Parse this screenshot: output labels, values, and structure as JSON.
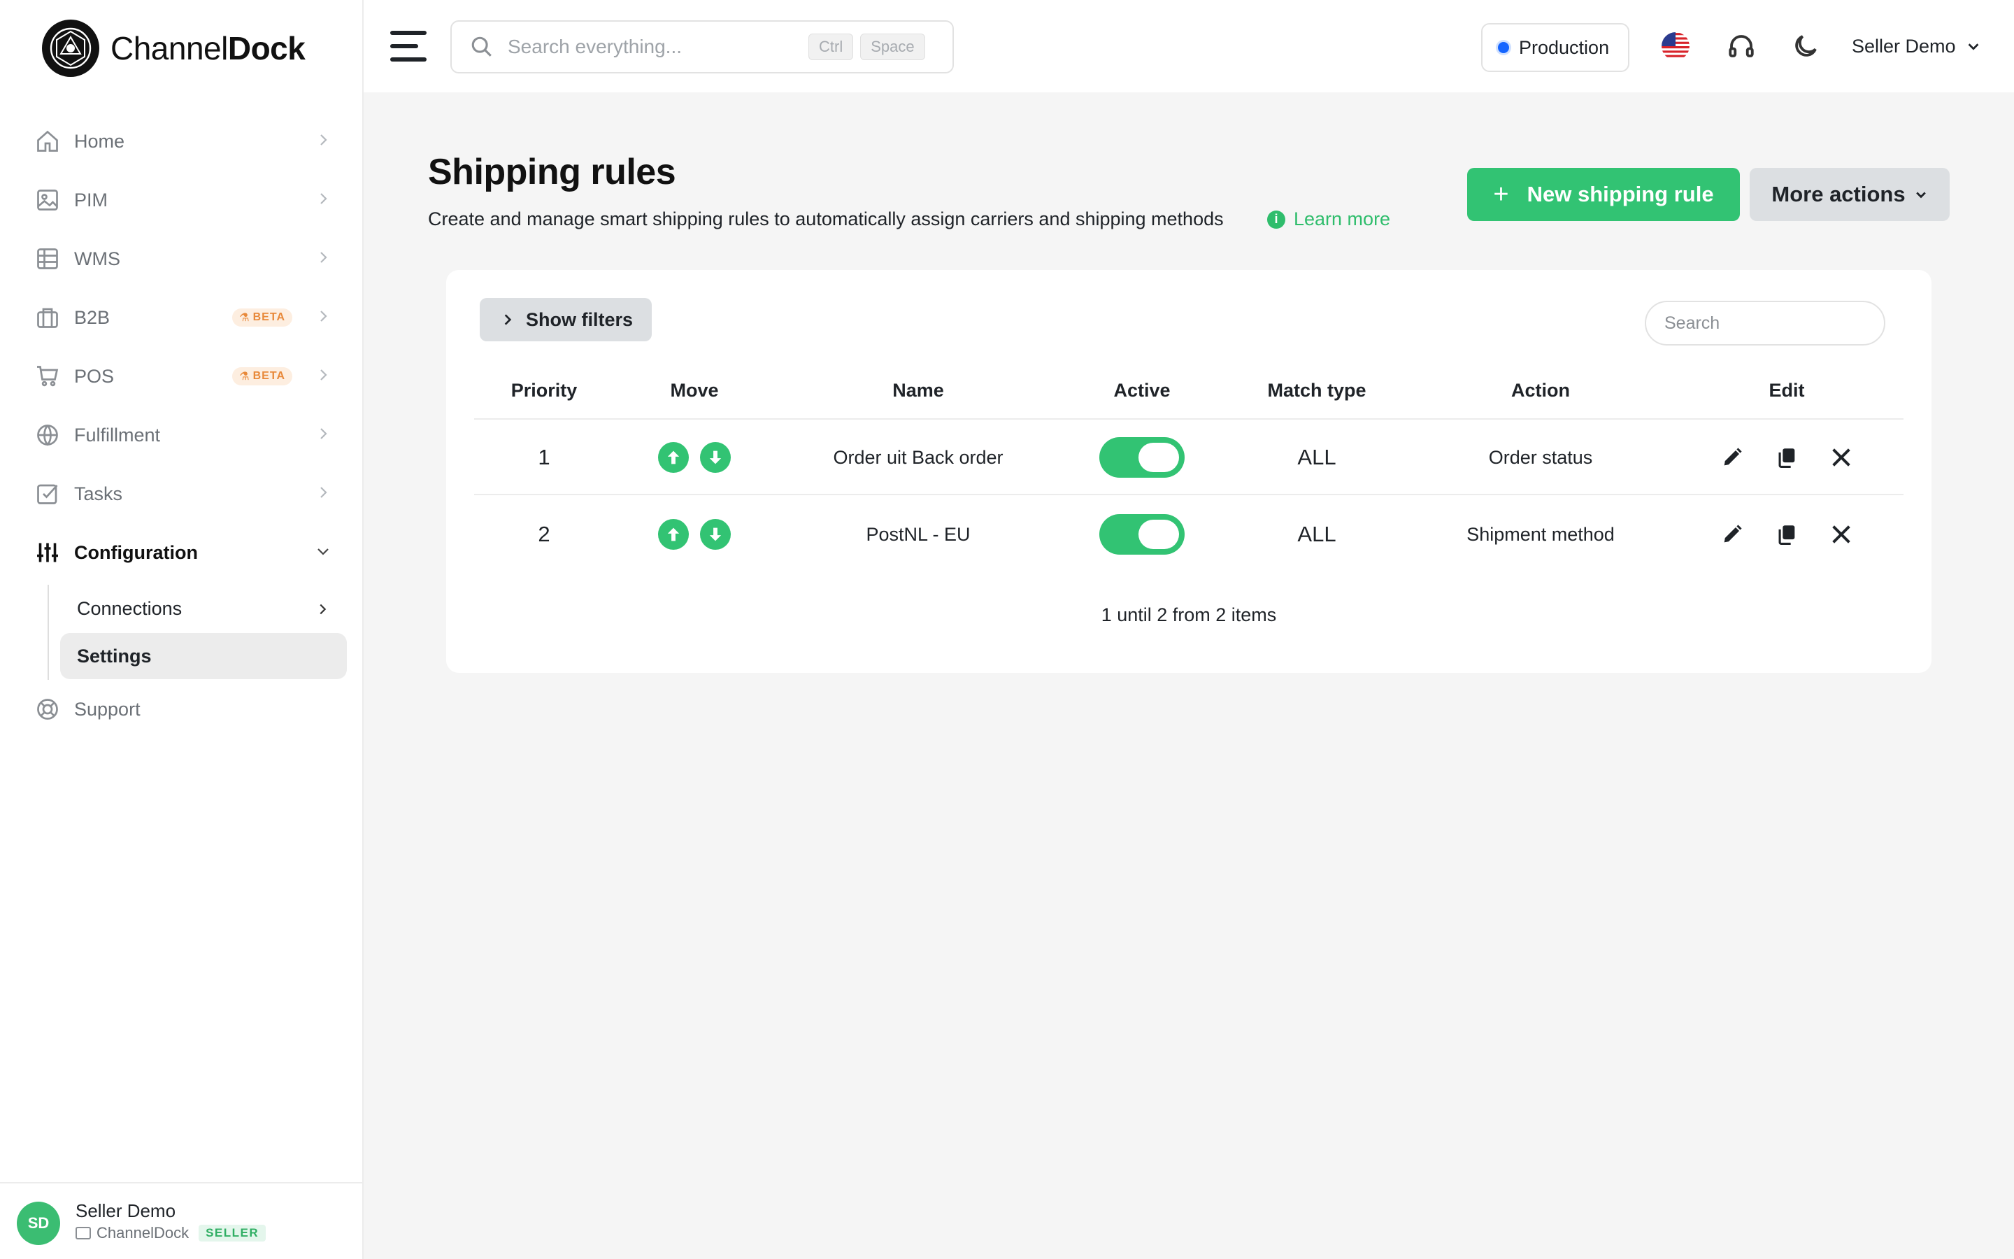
{
  "brand": {
    "name_light": "Channel",
    "name_bold": "Dock"
  },
  "sidebar": {
    "items": [
      {
        "label": "Home",
        "icon": "home-icon"
      },
      {
        "label": "PIM",
        "icon": "image-icon"
      },
      {
        "label": "WMS",
        "icon": "grid-icon"
      },
      {
        "label": "B2B",
        "icon": "briefcase-icon",
        "badge": "BETA"
      },
      {
        "label": "POS",
        "icon": "cart-icon",
        "badge": "BETA"
      },
      {
        "label": "Fulfillment",
        "icon": "globe-icon"
      },
      {
        "label": "Tasks",
        "icon": "checkbox-icon"
      },
      {
        "label": "Configuration",
        "icon": "sliders-icon",
        "expanded": true
      },
      {
        "label": "Support",
        "icon": "lifebuoy-icon"
      }
    ],
    "subitems": [
      {
        "label": "Connections"
      },
      {
        "label": "Settings",
        "selected": true
      }
    ],
    "user": {
      "initials": "SD",
      "name": "Seller Demo",
      "org": "ChannelDock",
      "role": "SELLER"
    }
  },
  "topbar": {
    "search_placeholder": "Search everything...",
    "shortcut_keys": [
      "Ctrl",
      "Space"
    ],
    "environment": "Production",
    "user_menu": "Seller Demo"
  },
  "page": {
    "title": "Shipping rules",
    "description": "Create and manage smart shipping rules to automatically assign carriers and shipping methods",
    "learn_more": "Learn more",
    "new_button": "New shipping rule",
    "more_button": "More actions"
  },
  "table": {
    "show_filters": "Show filters",
    "search_placeholder": "Search",
    "columns": [
      "Priority",
      "Move",
      "Name",
      "Active",
      "Match type",
      "Action",
      "Edit"
    ],
    "rows": [
      {
        "priority": "1",
        "name": "Order uit Back order",
        "active": true,
        "match_type": "ALL",
        "action": "Order status"
      },
      {
        "priority": "2",
        "name": "PostNL - EU",
        "active": true,
        "match_type": "ALL",
        "action": "Shipment method"
      }
    ],
    "pagination": "1 until 2 from 2 items"
  },
  "colors": {
    "accent": "#32c373",
    "env_dot": "#1565ff",
    "beta_text": "#e8893a"
  }
}
